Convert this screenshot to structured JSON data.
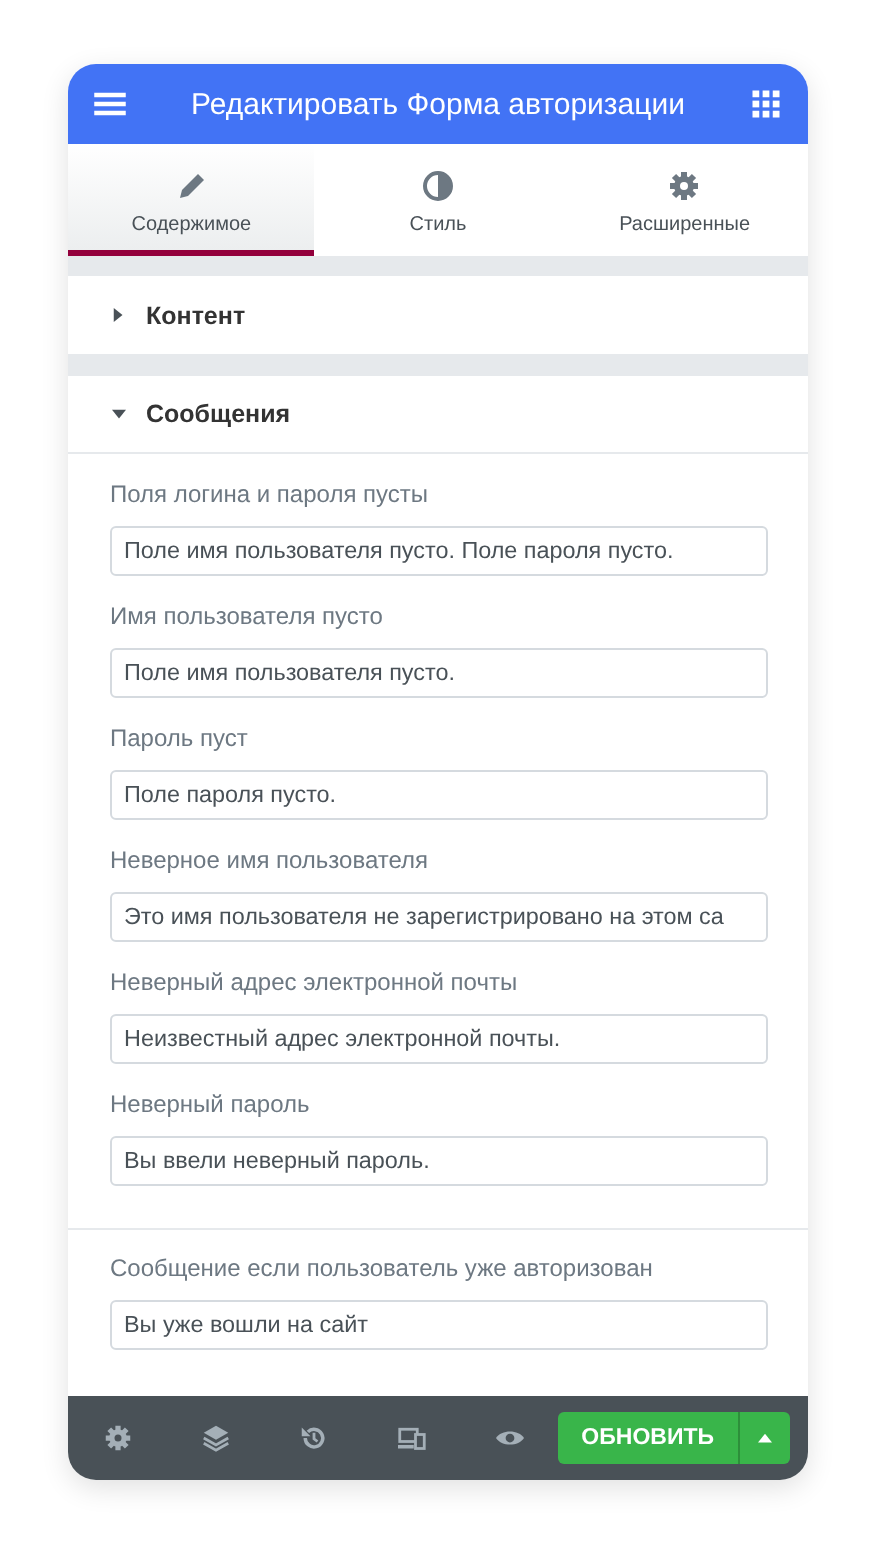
{
  "header": {
    "title": "Редактировать Форма авторизации"
  },
  "tabs": [
    {
      "label": "Содержимое",
      "selected": true
    },
    {
      "label": "Стиль",
      "selected": false
    },
    {
      "label": "Расширенные",
      "selected": false
    }
  ],
  "sections": [
    {
      "title": "Контент",
      "expanded": false
    },
    {
      "title": "Сообщения",
      "expanded": true,
      "groups": [
        {
          "fields": [
            {
              "label": "Поля логина и пароля пусты",
              "value": "Поле имя пользователя пусто. Поле пароля пусто."
            },
            {
              "label": "Имя пользователя пусто",
              "value": "Поле имя пользователя пусто."
            },
            {
              "label": "Пароль пуст",
              "value": "Поле пароля пусто."
            },
            {
              "label": "Неверное имя пользователя",
              "value": "Это имя пользователя не зарегистрировано на этом са"
            },
            {
              "label": "Неверный адрес электронной почты",
              "value": "Неизвестный адрес электронной почты."
            },
            {
              "label": "Неверный пароль",
              "value": "Вы ввели неверный пароль."
            }
          ]
        },
        {
          "fields": [
            {
              "label": "Сообщение если пользователь уже авторизован",
              "value": "Вы уже вошли на сайт"
            }
          ]
        }
      ]
    }
  ],
  "footer": {
    "update_button": "ОБНОВИТЬ"
  }
}
